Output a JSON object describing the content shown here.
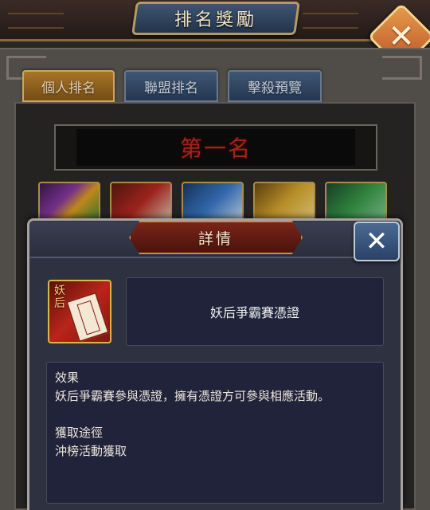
{
  "header": {
    "title": "排名獎勵",
    "close_label": "✕"
  },
  "tabs": [
    {
      "label": "個人排名",
      "active": true
    },
    {
      "label": "聯盟排名",
      "active": false
    },
    {
      "label": "擊殺預覽",
      "active": false
    }
  ],
  "rank": {
    "label": "第一名"
  },
  "rewards": [
    {
      "icon": "rainbow-token-icon"
    },
    {
      "icon": "red-certificate-icon"
    },
    {
      "icon": "blue-scroll-icon"
    },
    {
      "icon": "gold-emblem-icon"
    },
    {
      "icon": "green-robe-icon"
    }
  ],
  "detail": {
    "title": "詳情",
    "close_label": "✕",
    "item_tag": "妖后",
    "item_name": "妖后爭霸賽憑證",
    "effect_heading": "效果",
    "effect_text": "妖后爭霸賽參與憑證，擁有憑證方可參與相應活動。",
    "source_heading": "獲取途徑",
    "source_text": "沖榜活動獲取"
  },
  "colors": {
    "active_tab": "#c48a2e",
    "inactive_tab": "#3a5478",
    "rank_text": "#c42a1a",
    "popup_bg": "#2e3140",
    "detail_title_bg": "#6a1e14"
  }
}
